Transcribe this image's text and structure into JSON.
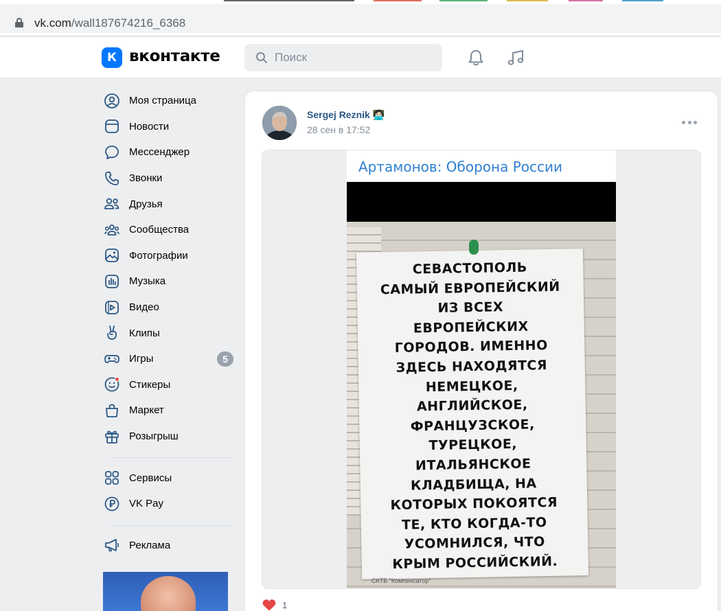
{
  "browser": {
    "url_host": "vk.com",
    "url_path": "/wall187674216_6368"
  },
  "header": {
    "logo_letter": "К",
    "wordmark": "вконтакте",
    "search_placeholder": "Поиск",
    "icons": [
      "search-icon",
      "bell-icon",
      "music-icon"
    ],
    "brand_color": "#0077ff"
  },
  "sidebar": {
    "items": [
      {
        "label": "Моя страница",
        "icon": "profile-icon"
      },
      {
        "label": "Новости",
        "icon": "news-icon"
      },
      {
        "label": "Мессенджер",
        "icon": "messenger-icon"
      },
      {
        "label": "Звонки",
        "icon": "phone-icon"
      },
      {
        "label": "Друзья",
        "icon": "friends-icon"
      },
      {
        "label": "Сообщества",
        "icon": "communities-icon"
      },
      {
        "label": "Фотографии",
        "icon": "photos-icon"
      },
      {
        "label": "Музыка",
        "icon": "music-icon"
      },
      {
        "label": "Видео",
        "icon": "video-icon"
      },
      {
        "label": "Клипы",
        "icon": "clips-icon"
      },
      {
        "label": "Игры",
        "icon": "games-icon",
        "badge": "5"
      },
      {
        "label": "Стикеры",
        "icon": "stickers-icon"
      },
      {
        "label": "Маркет",
        "icon": "market-icon"
      },
      {
        "label": "Розыгрыш",
        "icon": "gift-icon"
      }
    ],
    "items2": [
      {
        "label": "Сервисы",
        "icon": "services-icon"
      },
      {
        "label": "VK Pay",
        "icon": "vkpay-icon"
      }
    ],
    "items3": [
      {
        "label": "Реклама",
        "icon": "megaphone-icon"
      }
    ]
  },
  "post": {
    "author": "Sergej Reznik",
    "author_emoji": "🧑🏻‍💻",
    "date": "28 сен в 17:52",
    "image": {
      "channel_title": "Артамонов: Оборона России",
      "sign_text": "СЕВАСТОПОЛЬ\nСАМЫЙ ЕВРОПЕЙСКИЙ\nИЗ ВСЕХ\nЕВРОПЕЙСКИХ\nГОРОДОВ. ИМЕННО\nЗДЕСЬ НАХОДЯТСЯ\nНЕМЕЦКОЕ,\nАНГЛИЙСКОЕ,\nФРАНЦУЗСКОЕ,\nТУРЕЦКОЕ,\nИТАЛЬЯНСКОЕ\nКЛАДБИЩА, НА\nКОТОРЫХ ПОКОЯТСЯ\nТЕ, КТО КОГДА-ТО\nУСОМНИЛСЯ, ЧТО\nКРЫМ РОССИЙСКИЙ.",
      "footer_tag": "СКТБ \"Компенсатор\""
    },
    "likes": "1",
    "like_color": "#e64646"
  }
}
